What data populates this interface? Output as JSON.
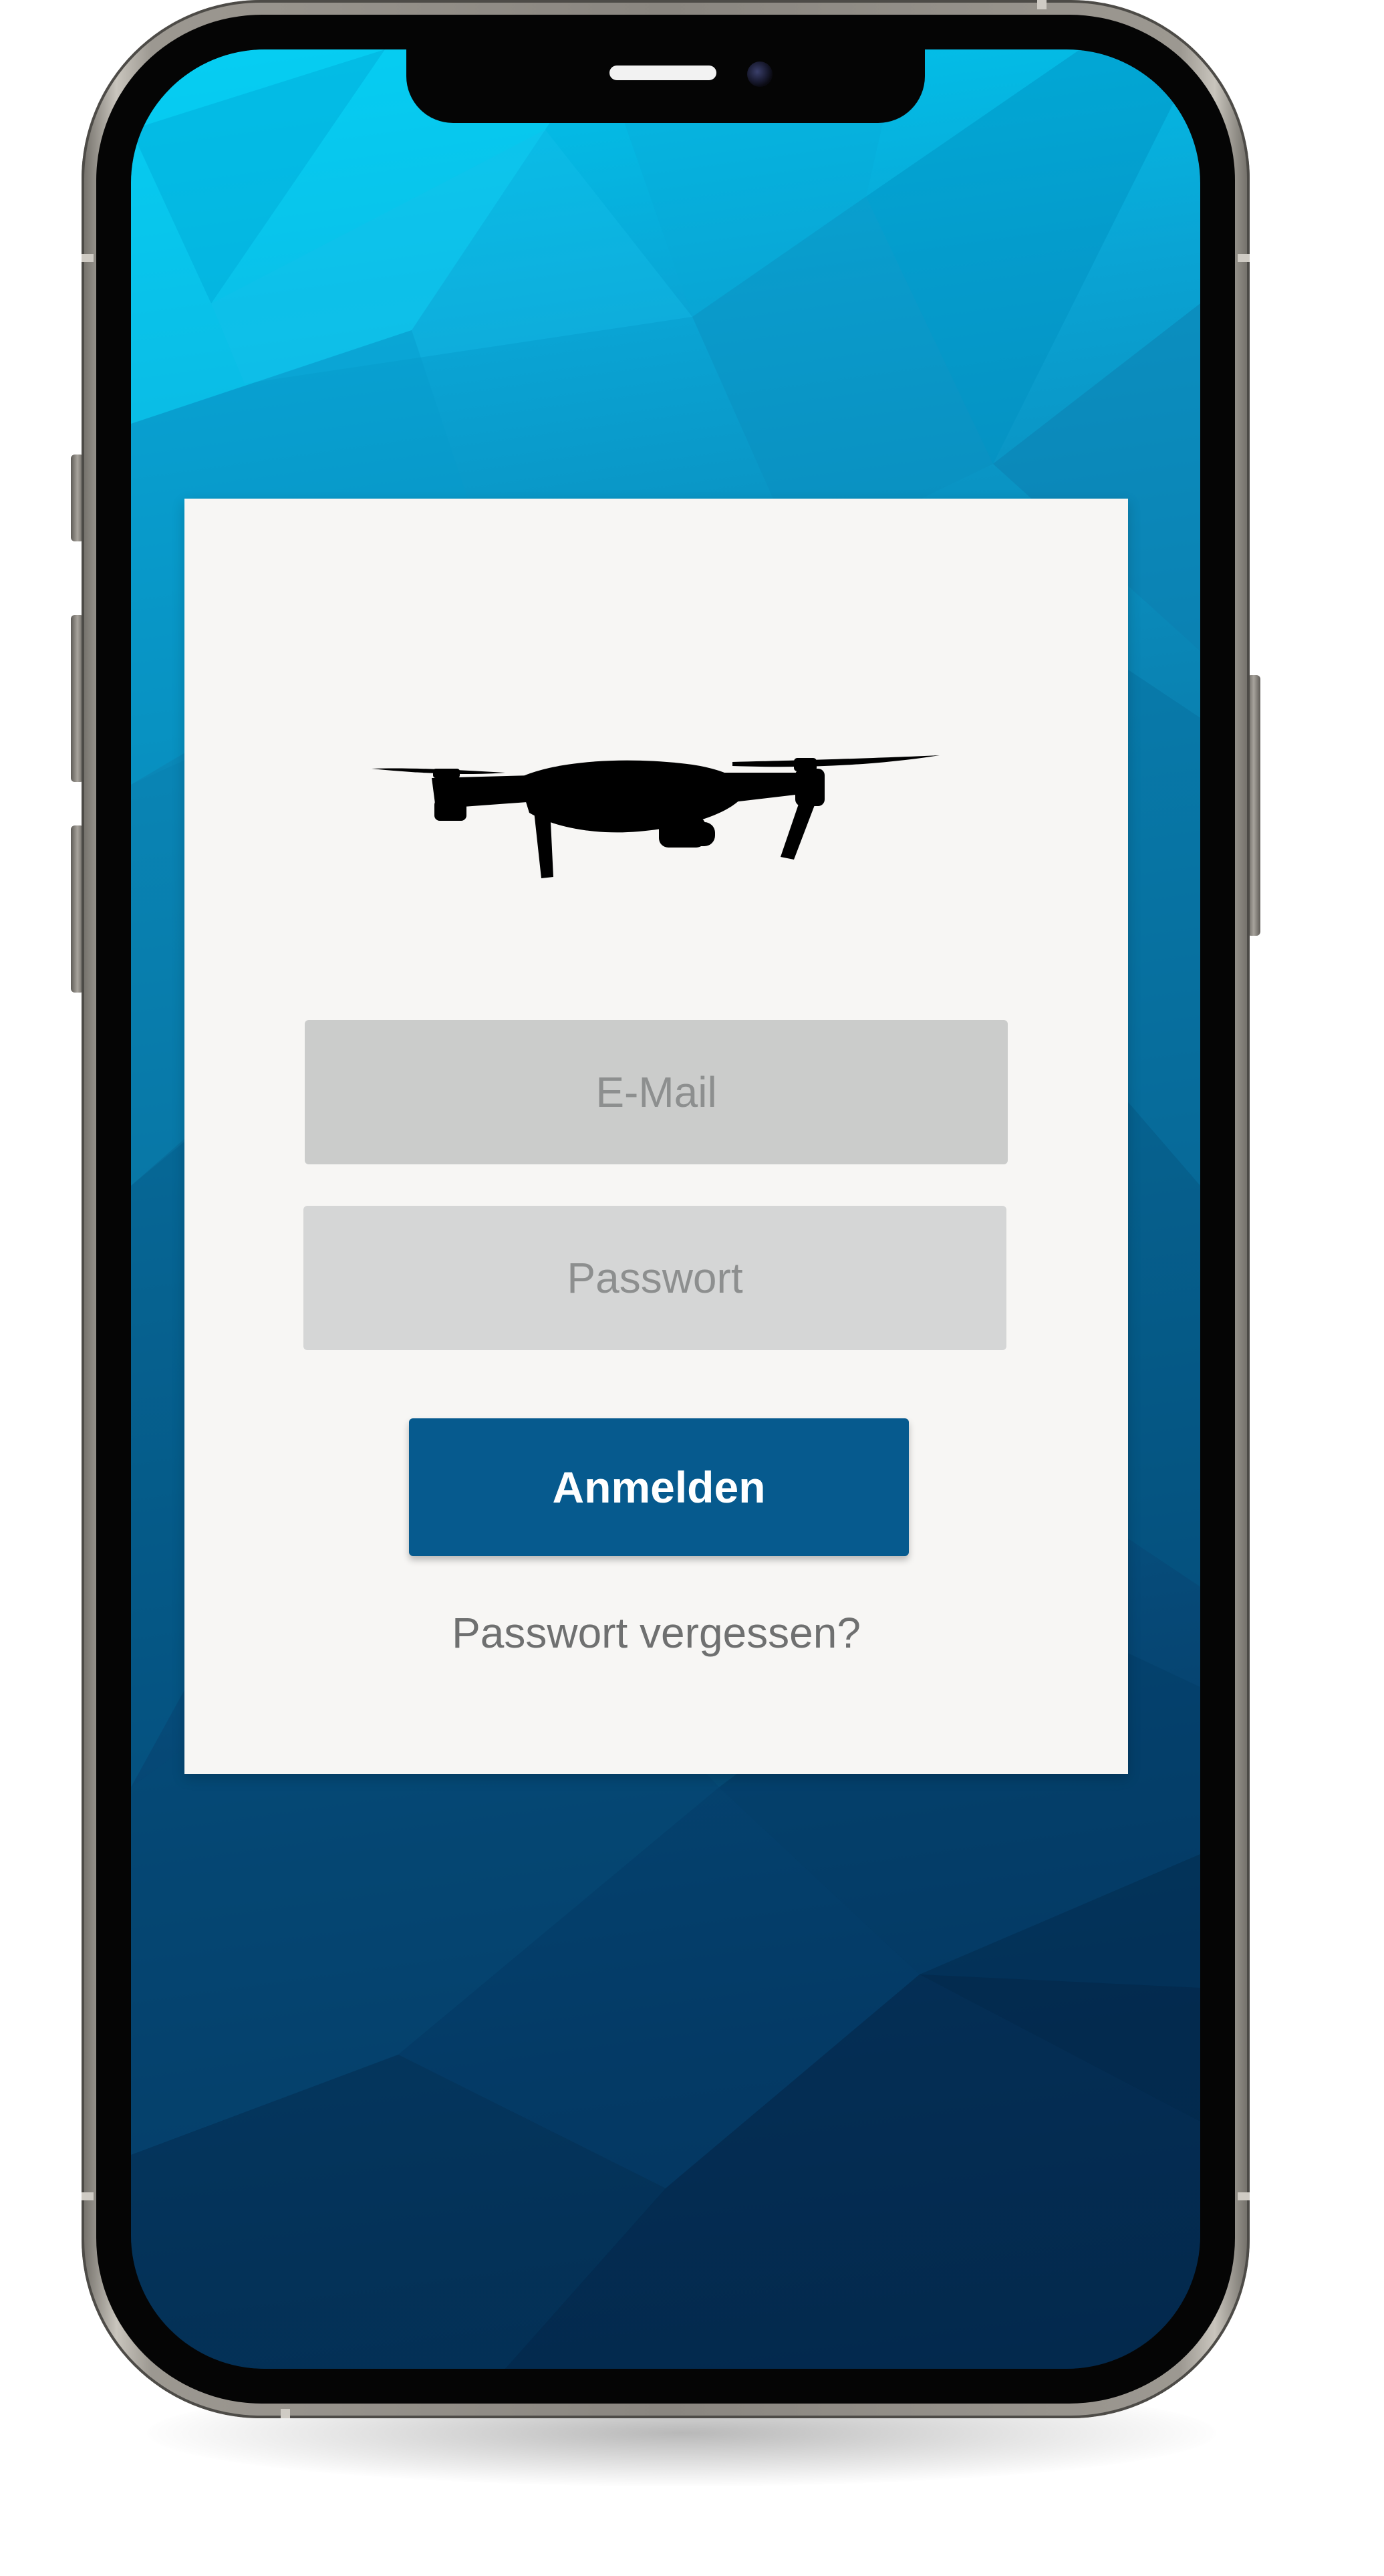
{
  "login": {
    "email_placeholder": "E-Mail",
    "password_placeholder": "Passwort",
    "submit_label": "Anmelden",
    "forgot_password_label": "Passwort vergessen?"
  },
  "icons": {
    "logo": "drone-icon"
  },
  "colors": {
    "background_top": "#00c8ef",
    "background_bottom": "#04284d",
    "card": "#f7f6f4",
    "email_field": "#cbcccb",
    "password_field": "#d5d6d6",
    "button": "#065a8e",
    "button_text": "#ffffff",
    "link_text": "#6f7070"
  }
}
